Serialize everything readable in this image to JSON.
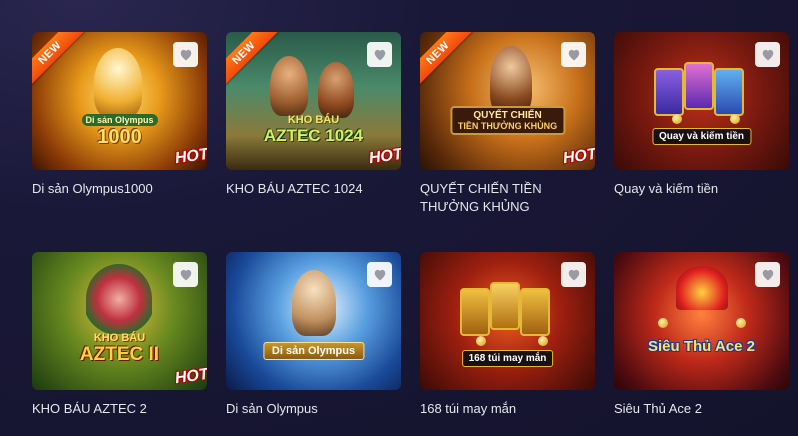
{
  "games": [
    {
      "title": "Di sản Olympus1000",
      "badge": "NEW",
      "hot": "HOT",
      "logo_top": "Di sản Olympus",
      "logo_main": "1000"
    },
    {
      "title": "KHO BÁU AZTEC 1024",
      "badge": "NEW",
      "hot": "HOT",
      "logo_top": "KHO BÁU",
      "logo_main": "AZTEC 1024"
    },
    {
      "title": "QUYẾT CHIẾN TIỀN THƯỞNG KHỦNG",
      "badge": "NEW",
      "hot": "HOT",
      "logo_top": "QUYẾT CHIẾN",
      "logo_main": "TIỀN THƯỞNG KHỦNG"
    },
    {
      "title": "Quay và kiếm tiền",
      "badge": "",
      "hot": "",
      "logo_top": "",
      "logo_main": "Quay và kiếm tiền"
    },
    {
      "title": "KHO BÁU AZTEC 2",
      "badge": "",
      "hot": "HOT",
      "logo_top": "KHO BÁU",
      "logo_main": "AZTEC II"
    },
    {
      "title": "Di sản Olympus",
      "badge": "",
      "hot": "",
      "logo_top": "",
      "logo_main": "Di sản Olympus"
    },
    {
      "title": "168 túi may mắn",
      "badge": "",
      "hot": "",
      "logo_top": "",
      "logo_main": "168 túi may mắn"
    },
    {
      "title": "Siêu Thủ Ace 2",
      "badge": "",
      "hot": "",
      "logo_top": "",
      "logo_main": "Siêu Thủ Ace 2"
    }
  ],
  "icons": {
    "favorite": "heart-icon"
  },
  "colors": {
    "background": "#1a1838",
    "title_text": "#e6e6ee",
    "badge_new": "#f4611a",
    "hot": "#d01010"
  }
}
